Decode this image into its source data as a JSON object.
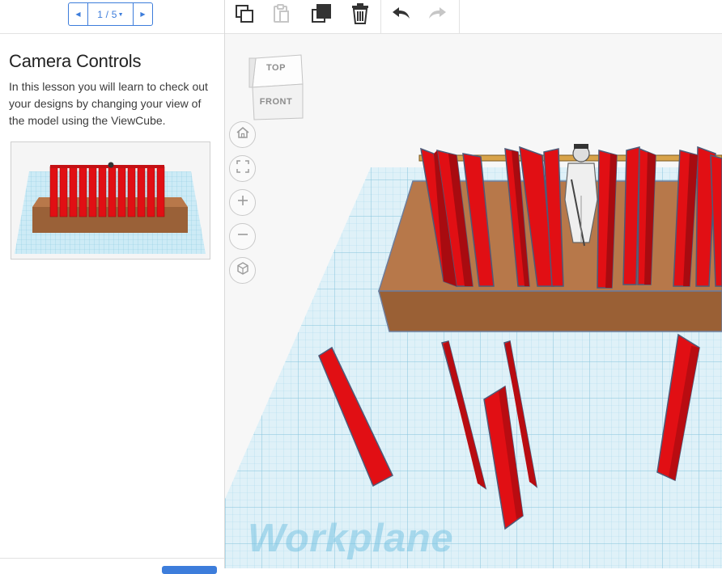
{
  "pager": {
    "count": "1 / 5"
  },
  "lesson": {
    "title": "Camera Controls",
    "description": "In this lesson you will learn to check out your designs by changing your view of the model using the ViewCube."
  },
  "toolbar": {
    "icons": [
      "copy-icon",
      "paste-icon",
      "duplicate-icon",
      "delete-icon",
      "undo-icon",
      "redo-icon"
    ]
  },
  "viewcube": {
    "top_label": "TOP",
    "front_label": "FRONT"
  },
  "nav": {
    "icons": [
      "home-icon",
      "fit-icon",
      "zoom-in-icon",
      "zoom-out-icon",
      "perspective-icon"
    ]
  },
  "workplane": {
    "label": "Workplane"
  },
  "colors": {
    "accent": "#3d7ddb",
    "workplane_grid": "#9fd3e8",
    "box_brown": "#a66a3e",
    "panel_red": "#e10f14"
  }
}
